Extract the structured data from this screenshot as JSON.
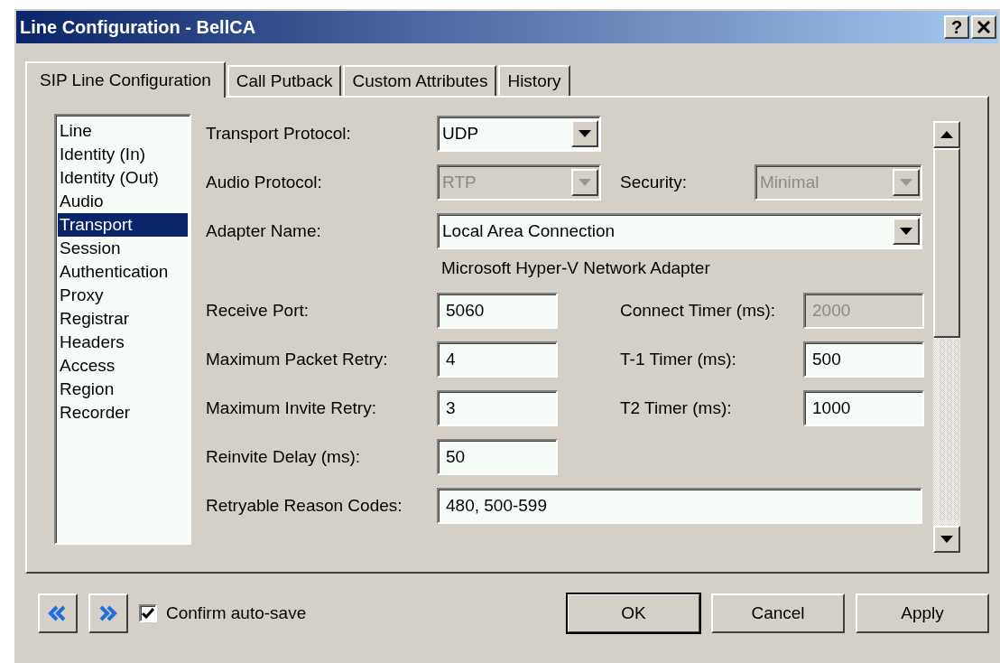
{
  "window": {
    "title": "Line Configuration - BellCA",
    "help_button": "?"
  },
  "tabs": [
    {
      "label": "SIP Line Configuration",
      "selected": true
    },
    {
      "label": "Call Putback",
      "selected": false
    },
    {
      "label": "Custom Attributes",
      "selected": false
    },
    {
      "label": "History",
      "selected": false
    }
  ],
  "sidebar": {
    "items": [
      {
        "label": "Line",
        "selected": false
      },
      {
        "label": "Identity (In)",
        "selected": false
      },
      {
        "label": "Identity (Out)",
        "selected": false
      },
      {
        "label": "Audio",
        "selected": false
      },
      {
        "label": "Transport",
        "selected": true
      },
      {
        "label": "Session",
        "selected": false
      },
      {
        "label": "Authentication",
        "selected": false
      },
      {
        "label": "Proxy",
        "selected": false
      },
      {
        "label": "Registrar",
        "selected": false
      },
      {
        "label": "Headers",
        "selected": false
      },
      {
        "label": "Access",
        "selected": false
      },
      {
        "label": "Region",
        "selected": false
      },
      {
        "label": "Recorder",
        "selected": false
      }
    ]
  },
  "form": {
    "rows": [
      {
        "left": {
          "label": "Transport Protocol:",
          "kind": "combo",
          "value": "UDP",
          "disabled": false
        }
      },
      {
        "left": {
          "label": "Audio Protocol:",
          "kind": "combo",
          "value": "RTP",
          "disabled": true
        },
        "right": {
          "label": "Security:",
          "kind": "combo",
          "value": "Minimal",
          "disabled": true
        }
      },
      {
        "left": {
          "label": "Adapter Name:",
          "kind": "wide-combo",
          "value": "Local Area Connection",
          "disabled": false
        }
      },
      {
        "note": "Microsoft Hyper-V Network Adapter"
      },
      {
        "left": {
          "label": "Receive Port:",
          "kind": "text",
          "value": "5060",
          "disabled": false
        },
        "right": {
          "label": "Connect Timer (ms):",
          "kind": "text",
          "value": "2000",
          "disabled": true
        }
      },
      {
        "left": {
          "label": "Maximum Packet Retry:",
          "kind": "text",
          "value": "4",
          "disabled": false
        },
        "right": {
          "label": "T-1 Timer (ms):",
          "kind": "text",
          "value": "500",
          "disabled": false
        }
      },
      {
        "left": {
          "label": "Maximum Invite Retry:",
          "kind": "text",
          "value": "3",
          "disabled": false
        },
        "right": {
          "label": "T2 Timer (ms):",
          "kind": "text",
          "value": "1000",
          "disabled": false
        }
      },
      {
        "left": {
          "label": "Reinvite Delay (ms):",
          "kind": "text",
          "value": "50",
          "disabled": false
        }
      },
      {
        "left": {
          "label": "Retryable Reason Codes:",
          "kind": "wide-text",
          "value": "480, 500-599",
          "disabled": false
        }
      }
    ]
  },
  "footer": {
    "confirm_checkbox": {
      "label": "Confirm auto-save",
      "checked": true
    },
    "buttons": [
      {
        "label": "OK",
        "default": true
      },
      {
        "label": "Cancel",
        "default": false
      },
      {
        "label": "Apply",
        "default": false
      }
    ]
  }
}
